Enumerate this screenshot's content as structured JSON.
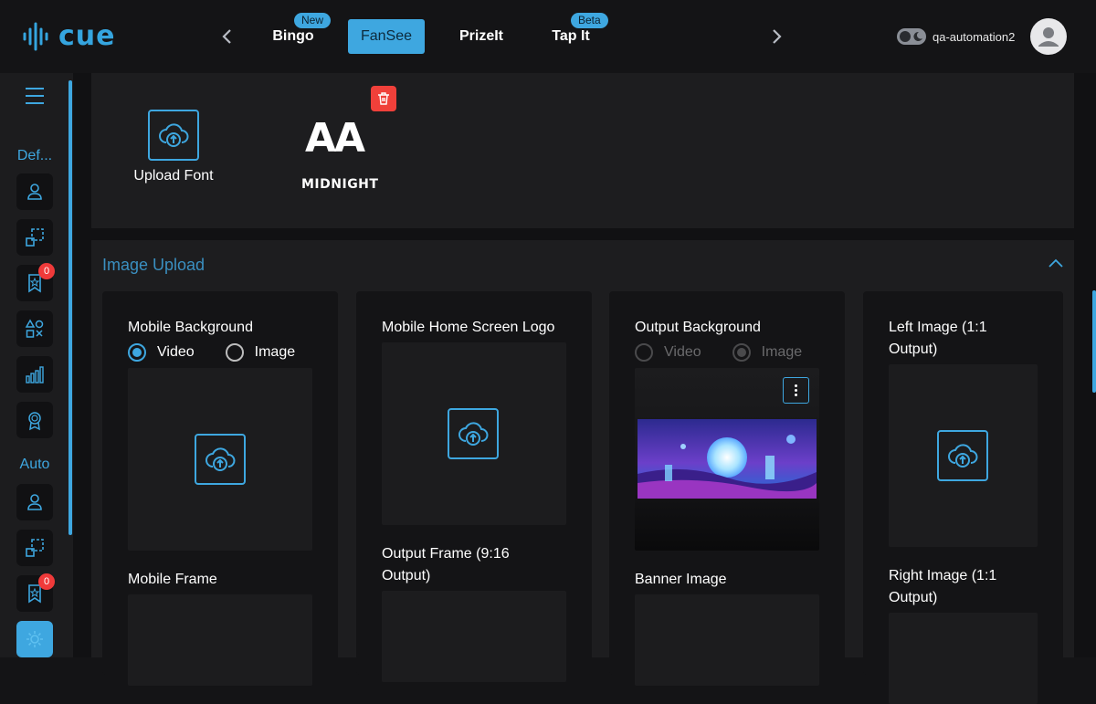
{
  "header": {
    "logo_text": "cue",
    "tabs": [
      {
        "label": "Bingo",
        "badge": "New",
        "active": false
      },
      {
        "label": "FanSee",
        "badge": "",
        "active": true
      },
      {
        "label": "PrizeIt",
        "badge": "",
        "active": false
      },
      {
        "label": "Tap It",
        "badge": "Beta",
        "active": false
      }
    ],
    "username": "qa-automation2"
  },
  "sidebar": {
    "group1_label": "Def...",
    "group2_label": "Auto",
    "badge_1": "0",
    "badge_2": "0"
  },
  "fonts": {
    "upload_label": "Upload Font",
    "sample_glyph": "AA",
    "sample_name": "MIDNIGHT"
  },
  "image_upload": {
    "title": "Image Upload",
    "cards": {
      "mobile_background": {
        "title": "Mobile Background",
        "option_video": "Video",
        "option_image": "Image",
        "selected": "Video"
      },
      "mobile_frame": {
        "title": "Mobile Frame"
      },
      "mobile_home_logo": {
        "title": "Mobile Home Screen Logo"
      },
      "output_frame": {
        "title": "Output Frame (9:16 Output)"
      },
      "output_background": {
        "title": "Output Background",
        "option_video": "Video",
        "option_image": "Image",
        "selected": "Image"
      },
      "banner_image": {
        "title": "Banner Image"
      },
      "left_image": {
        "title": "Left Image (1:1 Output)"
      },
      "right_image": {
        "title": "Right Image (1:1 Output)"
      }
    }
  },
  "colors": {
    "accent": "#3ea7e0",
    "danger": "#f0403a",
    "panel": "#1d1d1f",
    "background": "#111113"
  }
}
